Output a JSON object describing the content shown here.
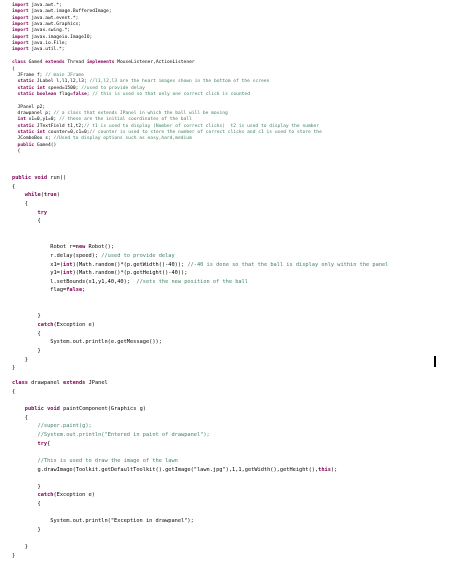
{
  "code": {
    "upper": [
      "import java.awt.*;",
      "import java.awt.image.BufferedImage;",
      "import java.awt.event.*;",
      "import java.awt.Graphics;",
      "import javax.swing.*;",
      "import javax.imageio.ImageIO;",
      "import java.io.File;",
      "import java.util.*;",
      "",
      "class Game4 extends Thread implements MouseListener,ActionListener",
      "{",
      "  JFrame f; // main JFrame",
      "  static JLabel l,l1,l2,l3; //l1,l2,l3 are the heart images shown in the bottom of the screen",
      "  static int speed=1500; //used to provide delay",
      "  static boolean flag=false; // this is used so that only one correct click is counted",
      "",
      "  JPanel p2;",
      "  drawpanel p; // a class that extends JPanel in which the ball will be moving",
      "  int x1=0,y1=0; // these are the initial coordinates of the ball",
      "  static JTextField t1,t2;// t1 is used to display (Number of correct clicks)  t2 is used to display the number",
      "  static int counter=0,c1=0;// counter is used to store the number of correct clicks and c1 is used to store the",
      "  JComboBox s; //Used to display options such as easy,hard,medium",
      "  public Game4()",
      "  {"
    ],
    "run": [
      "public void run()",
      "{",
      "    while(true)",
      "    {",
      "        try",
      "        {",
      "",
      "",
      "            Robot r=new Robot();",
      "            r.delay(speed); //used to provide delay",
      "            x1=(int)(Math.random()*(p.getWidth()-40)); //-40 is done so that the ball is display only within the panel",
      "            y1=(int)(Math.random()*(p.getHeight()-40));",
      "            l.setBounds(x1,y1,40,40);  //sets the new position of the ball",
      "            flag=false;",
      "",
      "",
      "        }",
      "        catch(Exception e)",
      "        {",
      "            System.out.println(e.getMessage());",
      "        }",
      "    }",
      "}"
    ],
    "drawpanel": [
      "class drawpanel extends JPanel",
      "{",
      "",
      "    public void paintComponent(Graphics g)",
      "    {",
      "        //super.paint(g);",
      "        //System.out.println(\"Entered in paint of drawpanel\");",
      "        try{",
      "",
      "        //This is used to draw the image of the lawn",
      "        g.drawImage(Toolkit.getDefaultToolkit().getImage(\"lawn.jpg\"),1,1,getWidth(),getHeight(),this);",
      "",
      "        }",
      "        catch(Exception e)",
      "        {",
      "",
      "            System.out.println(\"Exception in drawpanel\");",
      "        }",
      "",
      "    }",
      "}"
    ]
  }
}
